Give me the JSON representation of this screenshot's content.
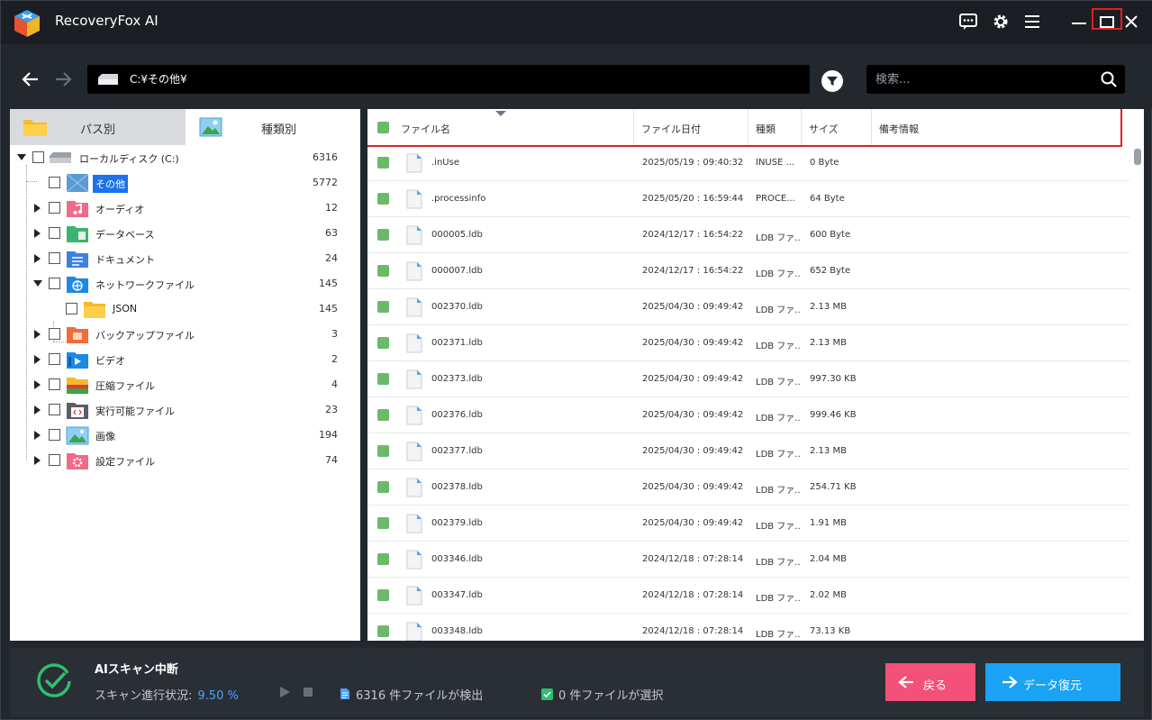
{
  "app": {
    "title": "RecoveryFox AI"
  },
  "nav": {
    "path": "C:¥その他¥",
    "search_placeholder": "検索..."
  },
  "tabs": [
    {
      "label": "パス別"
    },
    {
      "label": "種類別"
    }
  ],
  "tree": {
    "root": {
      "label": "ローカルディスク (C:)",
      "count": "6316"
    },
    "items": [
      {
        "label": "その他",
        "count": "5772",
        "selected": true
      },
      {
        "label": "オーディオ",
        "count": "12"
      },
      {
        "label": "データベース",
        "count": "63"
      },
      {
        "label": "ドキュメント",
        "count": "24"
      },
      {
        "label": "ネットワークファイル",
        "count": "145"
      },
      {
        "label": "JSON",
        "count": "145"
      },
      {
        "label": "バックアップファイル",
        "count": "3"
      },
      {
        "label": "ビデオ",
        "count": "2"
      },
      {
        "label": "圧縮ファイル",
        "count": "4"
      },
      {
        "label": "実行可能ファイル",
        "count": "23"
      },
      {
        "label": "画像",
        "count": "194"
      },
      {
        "label": "設定ファイル",
        "count": "74"
      }
    ]
  },
  "table": {
    "headers": {
      "name": "ファイル名",
      "date": "ファイル日付",
      "type": "種類",
      "size": "サイズ",
      "notes": "備考情報"
    },
    "rows": [
      {
        "name": ".inUse",
        "date": "2025/05/19 : 09:40:32",
        "type": "INUSE ...",
        "size": "0 Byte"
      },
      {
        "name": ".processinfo",
        "date": "2025/05/20 : 16:59:44",
        "type": "PROCE...",
        "size": "64 Byte"
      },
      {
        "name": "000005.ldb",
        "date": "2024/12/17 : 16:54:22",
        "type": "LDB ファ...",
        "size": "600 Byte"
      },
      {
        "name": "000007.ldb",
        "date": "2024/12/17 : 16:54:22",
        "type": "LDB ファ...",
        "size": "652 Byte"
      },
      {
        "name": "002370.ldb",
        "date": "2025/04/30 : 09:49:42",
        "type": "LDB ファ...",
        "size": "2.13 MB"
      },
      {
        "name": "002371.ldb",
        "date": "2025/04/30 : 09:49:42",
        "type": "LDB ファ...",
        "size": "2.13 MB"
      },
      {
        "name": "002373.ldb",
        "date": "2025/04/30 : 09:49:42",
        "type": "LDB ファ...",
        "size": "997.30 KB"
      },
      {
        "name": "002376.ldb",
        "date": "2025/04/30 : 09:49:42",
        "type": "LDB ファ...",
        "size": "999.46 KB"
      },
      {
        "name": "002377.ldb",
        "date": "2025/04/30 : 09:49:42",
        "type": "LDB ファ...",
        "size": "2.13 MB"
      },
      {
        "name": "002378.ldb",
        "date": "2025/04/30 : 09:49:42",
        "type": "LDB ファ...",
        "size": "254.71 KB"
      },
      {
        "name": "002379.ldb",
        "date": "2025/04/30 : 09:49:42",
        "type": "LDB ファ...",
        "size": "1.91 MB"
      },
      {
        "name": "003346.ldb",
        "date": "2024/12/18 : 07:28:14",
        "type": "LDB ファ...",
        "size": "2.04 MB"
      },
      {
        "name": "003347.ldb",
        "date": "2024/12/18 : 07:28:14",
        "type": "LDB ファ...",
        "size": "2.02 MB"
      },
      {
        "name": "003348.ldb",
        "date": "2024/12/18 : 07:28:14",
        "type": "LDB ファ...",
        "size": "73.13 KB"
      }
    ]
  },
  "bottom": {
    "scan_title": "AIスキャン中断",
    "status_label": "スキャン進行状況:",
    "progress": "9.50 %",
    "found_count": "6316",
    "found_text": "件ファイルが検出",
    "selected_count": "0",
    "selected_text": "件ファイルが選択",
    "back_label": "戻る",
    "recover_label": "データ復元"
  },
  "colors": {
    "accent_blue": "#1aa3f4",
    "back_pink": "#f4517a",
    "check_green": "#6cb96c",
    "highlight_red": "#e02020"
  }
}
